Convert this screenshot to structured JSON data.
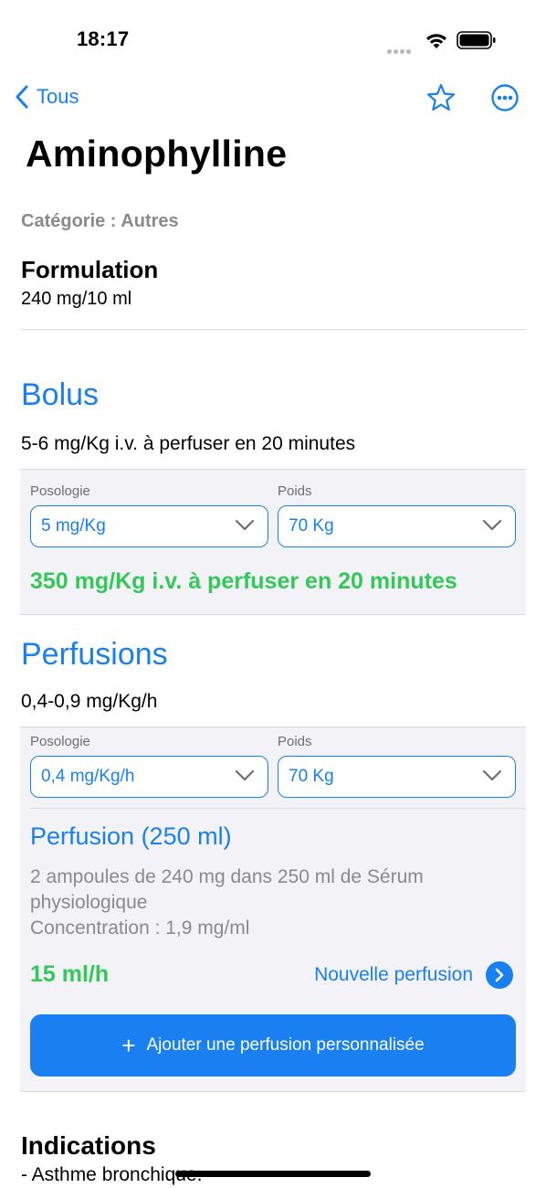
{
  "status_bar": {
    "time": "18:17"
  },
  "nav": {
    "back_label": "Tous",
    "back_icon": "chevron-left-icon",
    "favorite_icon": "star-outline-icon",
    "more_icon": "ellipsis-circle-icon"
  },
  "drug": {
    "name": "Aminophylline",
    "category": "Catégorie : Autres",
    "formulation_title": "Formulation",
    "formulation_value": "240 mg/10 ml"
  },
  "bolus": {
    "title": "Bolus",
    "description": "5-6 mg/Kg i.v. à perfuser en 20 minutes",
    "dosage_label": "Posologie",
    "dosage_value": "5 mg/Kg",
    "weight_label": "Poids",
    "weight_value": "70 Kg",
    "result": "350 mg/Kg i.v. à perfuser en 20 minutes"
  },
  "perfusions": {
    "title": "Perfusions",
    "description": "0,4-0,9 mg/Kg/h",
    "dosage_label": "Posologie",
    "dosage_value": "0,4 mg/Kg/h",
    "weight_label": "Poids",
    "weight_value": "70 Kg",
    "perfusion_title": "Perfusion (250 ml)",
    "perfusion_line1": "2 ampoules de 240 mg dans 250 ml de Sérum physiologique",
    "perfusion_line2": "Concentration : 1,9 mg/ml",
    "rate": "15 ml/h",
    "new_perfusion_label": "Nouvelle perfusion",
    "add_button_label": "Ajouter une perfusion personnalisée"
  },
  "indications": {
    "title": "Indications",
    "items": [
      "- Asthme bronchique."
    ]
  },
  "colors": {
    "accent": "#1a7ff0",
    "success": "#34c759",
    "secondary_text": "#8a8a8e",
    "panel_bg": "#f2f2f7"
  }
}
